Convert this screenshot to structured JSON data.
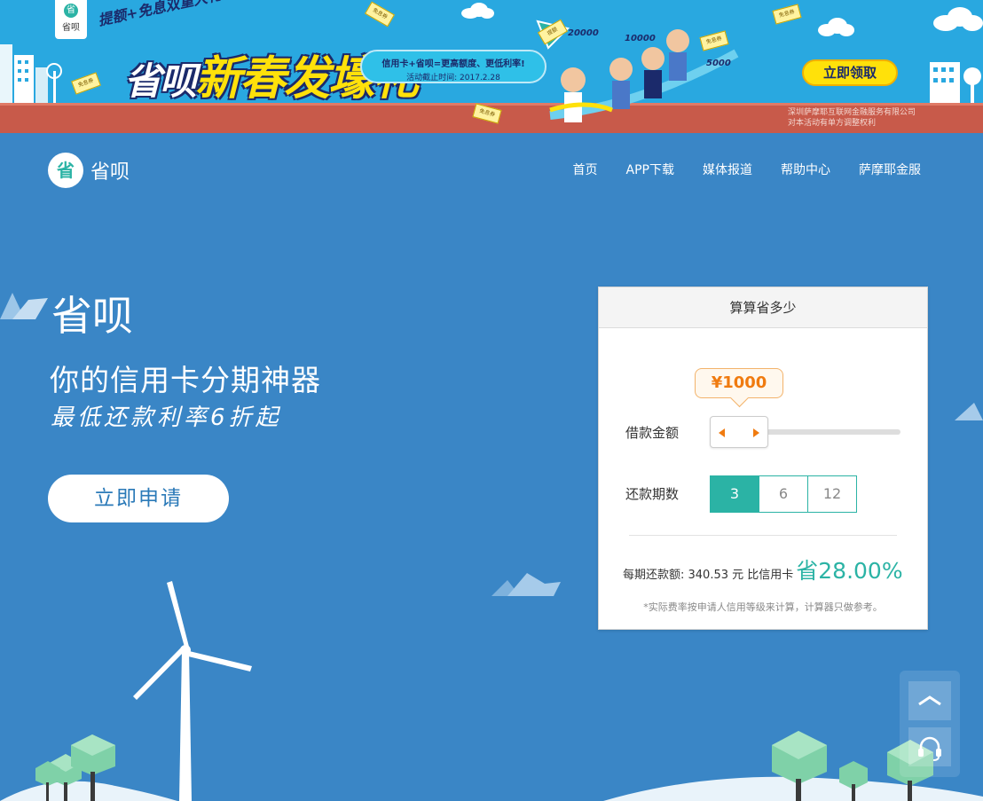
{
  "banner": {
    "logo_text": "省呗",
    "sub_slogan": "提额+免息双重大礼!",
    "main_slogan_brand": "省呗",
    "main_slogan": "新春发壕礼",
    "pill_line1": "信用卡+省呗=更高额度、更低利率!",
    "pill_line2": "活动截止时间: 2017.2.28",
    "claim_button": "立即领取",
    "disclaimer_line1": "深圳萨摩耶互联网金融服务有限公司",
    "disclaimer_line2": "对本活动有单方调整权利",
    "amounts": [
      "20000",
      "10000",
      "5000"
    ],
    "ticket_label": "免息券",
    "flag_label": "提额"
  },
  "nav": {
    "logo_mark": "省",
    "logo_text": "省呗",
    "items": [
      "首页",
      "APP下载",
      "媒体报道",
      "帮助中心",
      "萨摩耶金服"
    ]
  },
  "hero": {
    "title": "省呗",
    "subtitle": "你的信用卡分期神器",
    "tagline": "最低还款利率6折起",
    "apply_button": "立即申请"
  },
  "calculator": {
    "title": "算算省多少",
    "amount_bubble": "¥1000",
    "amount_label": "借款金额",
    "period_label": "还款期数",
    "periods": [
      "3",
      "6",
      "12"
    ],
    "active_period": "3",
    "result_prefix": "每期还款额: 340.53 元 比信用卡",
    "result_save": "省28.00%",
    "note": "*实际费率按申请人信用等级来计算，计算器只做参考。"
  },
  "colors": {
    "page_bg": "#3a86c6",
    "banner_bg": "#29a8e0",
    "accent_green": "#2bb3a5",
    "accent_orange": "#f07b10",
    "banner_yellow": "#ffe10a"
  },
  "icons": {
    "back_to_top": "chevron-up-icon",
    "customer_service": "headset-icon"
  }
}
